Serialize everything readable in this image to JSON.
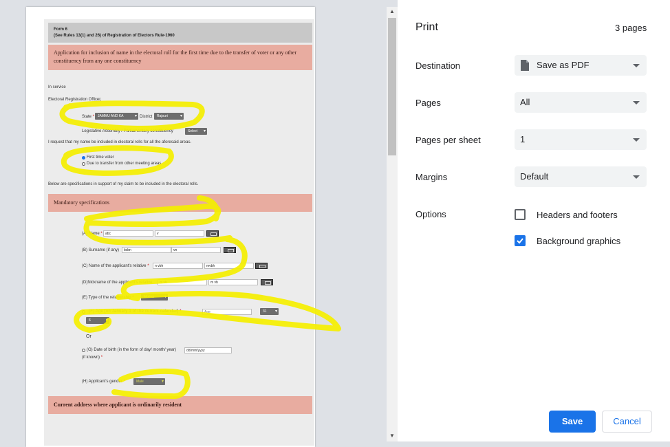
{
  "form": {
    "form_no": "Form 6",
    "rule_ref": "(See Rules 13(1) and 26) of Registration of Electors Rule-1960",
    "application_title": "Application for inclusion of name in the electoral roll for the first time due to the transfer of voter or any other constituency from any one constituency",
    "in_service": "In service",
    "ero": "Electoral Registration Officer,",
    "state_label": "State",
    "state_value": "JAMMU AND KA",
    "district_label": "District",
    "district_value": "Rajouri",
    "constituency_label": "Legislative Assembly / Parliamentary constituency",
    "constituency_value": "Select",
    "request_text": "I request that my name be included in electoral rolls for all the aforesaid areas.",
    "radio_first": "First time voter",
    "radio_transfer": "Due to transfer from other meeting areas.",
    "below_text": "Below are specifications in support of my claim to be included in the electoral rolls.",
    "mandatory_title": "Mandatory specifications",
    "name_label": "(A) Name",
    "name_val1": "abc",
    "name_val2": "v",
    "surname_label": "(B) Surname (if any)",
    "surname_val1": "bcbn",
    "surname_val2": "vn",
    "relative_label": "(C) Name of the applicant's relative",
    "relative_val1": "n vbh",
    "relative_val2": "mvbh",
    "nickname_label": "(D)Nickname of the applicant's relative",
    "nickname_val1": "m vh",
    "nickname_val2": "m vh",
    "relationship_label": "(E) Type of the relationship",
    "relationship_value": "Mother",
    "age_label": "(F)  Age  [on  January  1  of  the  current  calendar]",
    "age_placeholder": "Age",
    "age_day": "31",
    "age_month": "6",
    "or_text": "Or",
    "dob_label": "(G) Date of birth (in the form of day/ month/ year)",
    "dob_label2": "(if known)",
    "dob_placeholder": "dd/mm/yyyy",
    "gender_label": "(H) Applicant's gender",
    "gender_value": "Male",
    "address_title": "Current address where applicant is ordinarily resident",
    "required_mark": "*"
  },
  "print": {
    "title": "Print",
    "pages_count": "3 pages",
    "destination_label": "Destination",
    "destination_value": "Save as PDF",
    "pages_label": "Pages",
    "pages_value": "All",
    "per_sheet_label": "Pages per sheet",
    "per_sheet_value": "1",
    "margins_label": "Margins",
    "margins_value": "Default",
    "options_label": "Options",
    "headers_footers": "Headers and footers",
    "headers_footers_checked": false,
    "background_graphics": "Background graphics",
    "background_graphics_checked": true,
    "save_button": "Save",
    "cancel_button": "Cancel"
  },
  "colors": {
    "accent": "#1a73e8",
    "highlight": "#f5ef00",
    "section_pink": "#e8aca0"
  },
  "icons": [
    "pdf-file-icon",
    "chevron-down-icon",
    "check-icon",
    "keyboard-icon",
    "scroll-up-icon",
    "scroll-down-icon"
  ]
}
